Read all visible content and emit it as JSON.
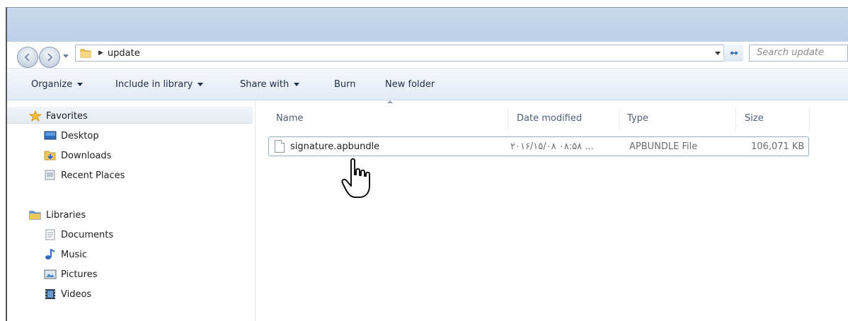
{
  "address": {
    "path": "update",
    "search_placeholder": "Search update"
  },
  "toolbar": {
    "organize": "Organize",
    "include_in_library": "Include in library",
    "share_with": "Share with",
    "burn": "Burn",
    "new_folder": "New folder"
  },
  "sidebar": {
    "favorites": {
      "label": "Favorites",
      "items": [
        "Desktop",
        "Downloads",
        "Recent Places"
      ]
    },
    "libraries": {
      "label": "Libraries",
      "items": [
        "Documents",
        "Music",
        "Pictures",
        "Videos"
      ]
    }
  },
  "columns": {
    "name": "Name",
    "date": "Date modified",
    "type": "Type",
    "size": "Size"
  },
  "files": [
    {
      "name": "signature.apbundle",
      "date": "۲۰۱۶/۱۵/۰۸ ۰۸:۵۸ ...",
      "type": "APBUNDLE File",
      "size": "106,071 KB"
    }
  ],
  "colors": {
    "accent": "#8fb0d2",
    "header_text": "#4c607a",
    "toolbar_text": "#1e2d47"
  },
  "icons": [
    "back-arrow-icon",
    "forward-arrow-icon",
    "folder-icon",
    "refresh-icon",
    "star-icon",
    "desktop-icon",
    "downloads-icon",
    "recent-places-icon",
    "libraries-icon",
    "documents-icon",
    "music-icon",
    "pictures-icon",
    "videos-icon",
    "file-icon",
    "hand-cursor-icon"
  ]
}
